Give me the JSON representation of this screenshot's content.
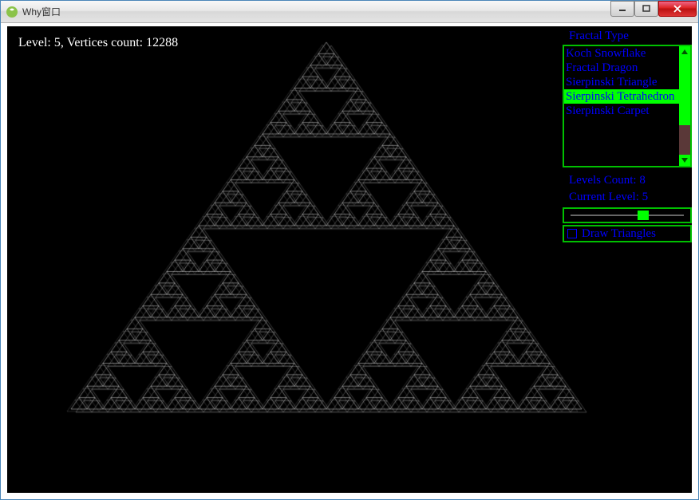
{
  "window": {
    "title": "Why窗口"
  },
  "status": {
    "level_label": "Level:",
    "level_value": 5,
    "vertices_label": "Vertices count:",
    "vertices_value": 12288,
    "full_text": "Level: 5, Vertices count: 12288"
  },
  "panel": {
    "fractal_type_label": "Fractal Type",
    "fractal_types": [
      "Koch Snowflake",
      "Fractal Dragon",
      "Sierpinski Triangle",
      "Sierpinski Tetrahedron",
      "Sierpinski Carpet"
    ],
    "selected_index": 3,
    "levels_count_label": "Levels Count: 8",
    "levels_count": 8,
    "current_level_label": "Current Level: 5",
    "current_level": 5,
    "draw_triangles_label": "Draw Triangles",
    "draw_triangles_checked": false
  },
  "colors": {
    "accent_green": "#00ff00",
    "accent_blue": "#0000ff",
    "canvas_bg": "#000000",
    "wire": "#ffffff"
  },
  "chart_data": {
    "type": "fractal",
    "name": "Sierpinski Tetrahedron",
    "level": 5,
    "vertices": 12288,
    "render_mode": "wireframe"
  }
}
